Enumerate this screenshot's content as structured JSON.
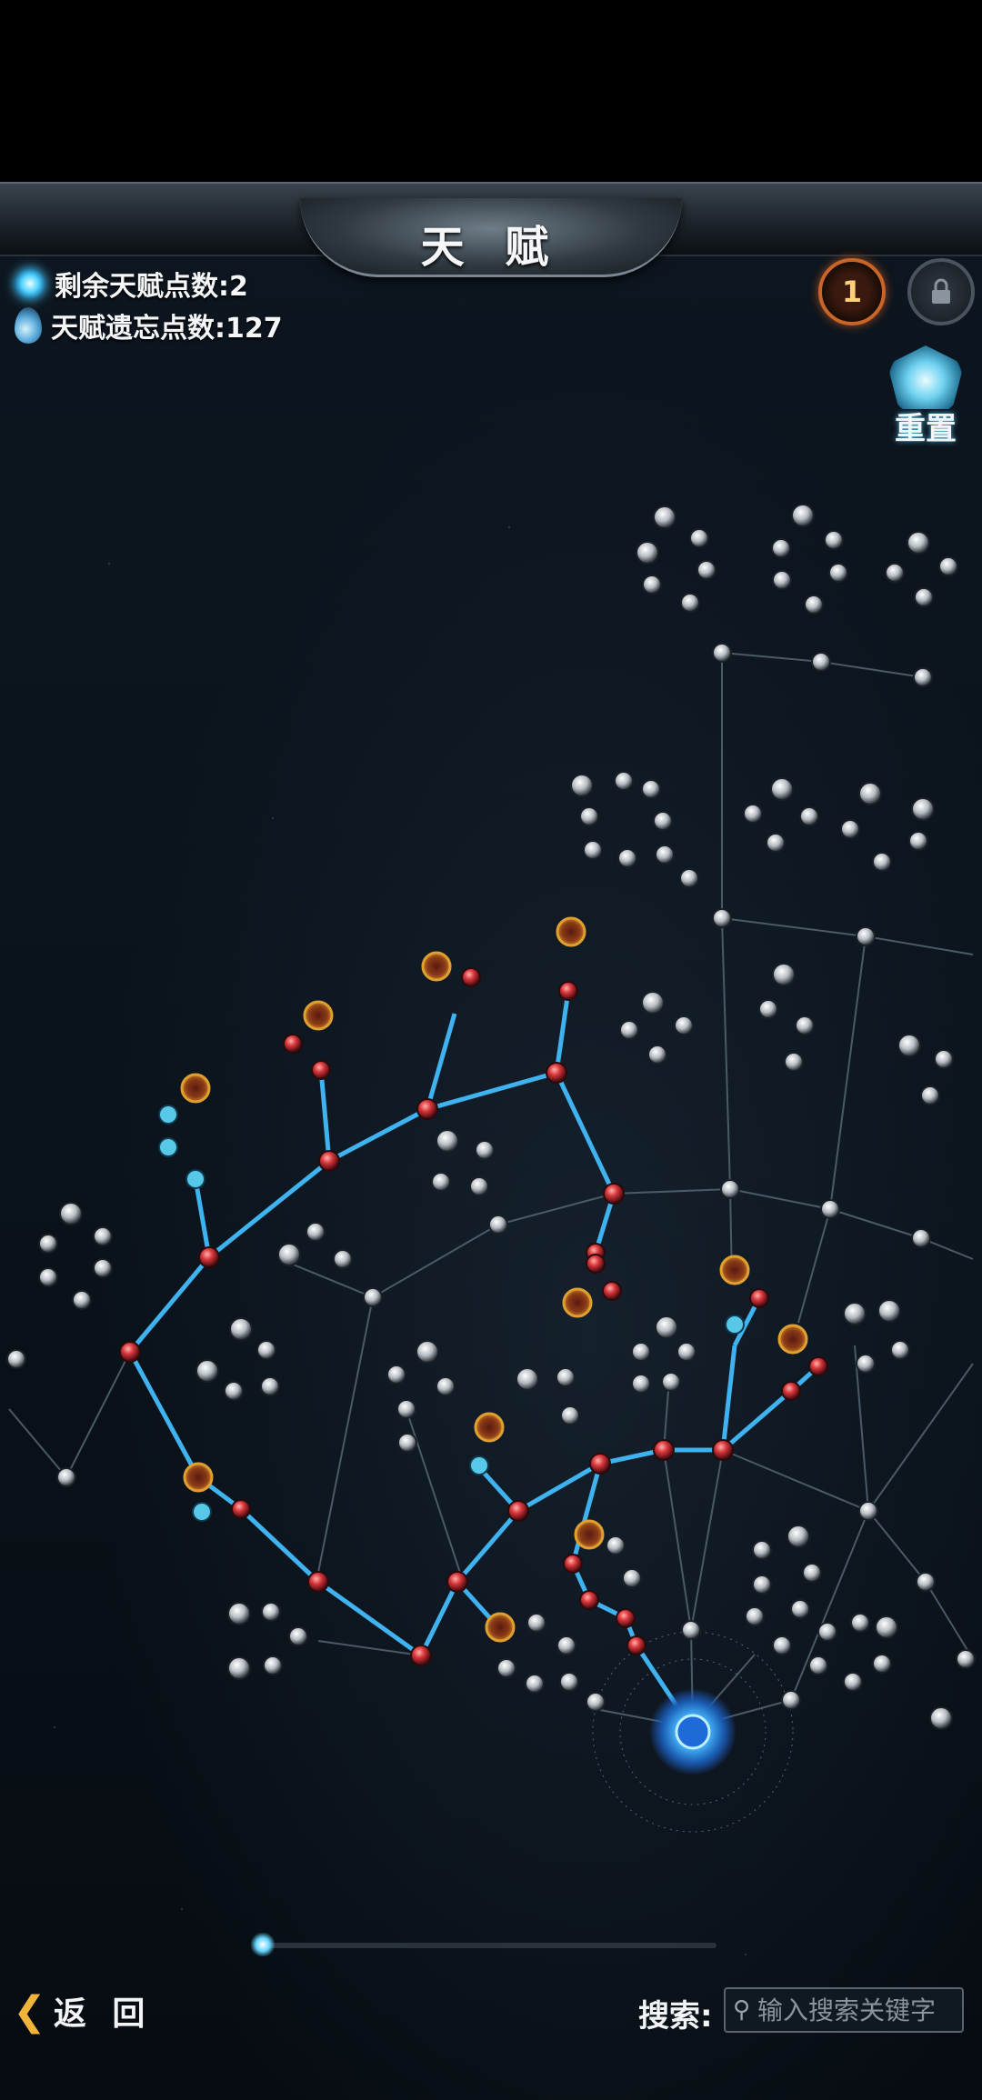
{
  "header": {
    "title": "天 赋"
  },
  "info": {
    "remaining_label": "剩余天赋点数:2",
    "forget_label": "天赋遗忘点数:127"
  },
  "buttons": {
    "level_badge": "1",
    "lock_icon": "lock-icon",
    "reset_label": "重置"
  },
  "bottom": {
    "back_label": "返 回",
    "search_label": "搜索:",
    "search_placeholder": "输入搜索关键字"
  },
  "colors": {
    "active_link": "#3fb2f0",
    "inactive_link": "#4a5a66",
    "active_node": "#d8363c",
    "inactive_node": "#c8ccd0",
    "accent_gold": "#e0a030"
  }
}
